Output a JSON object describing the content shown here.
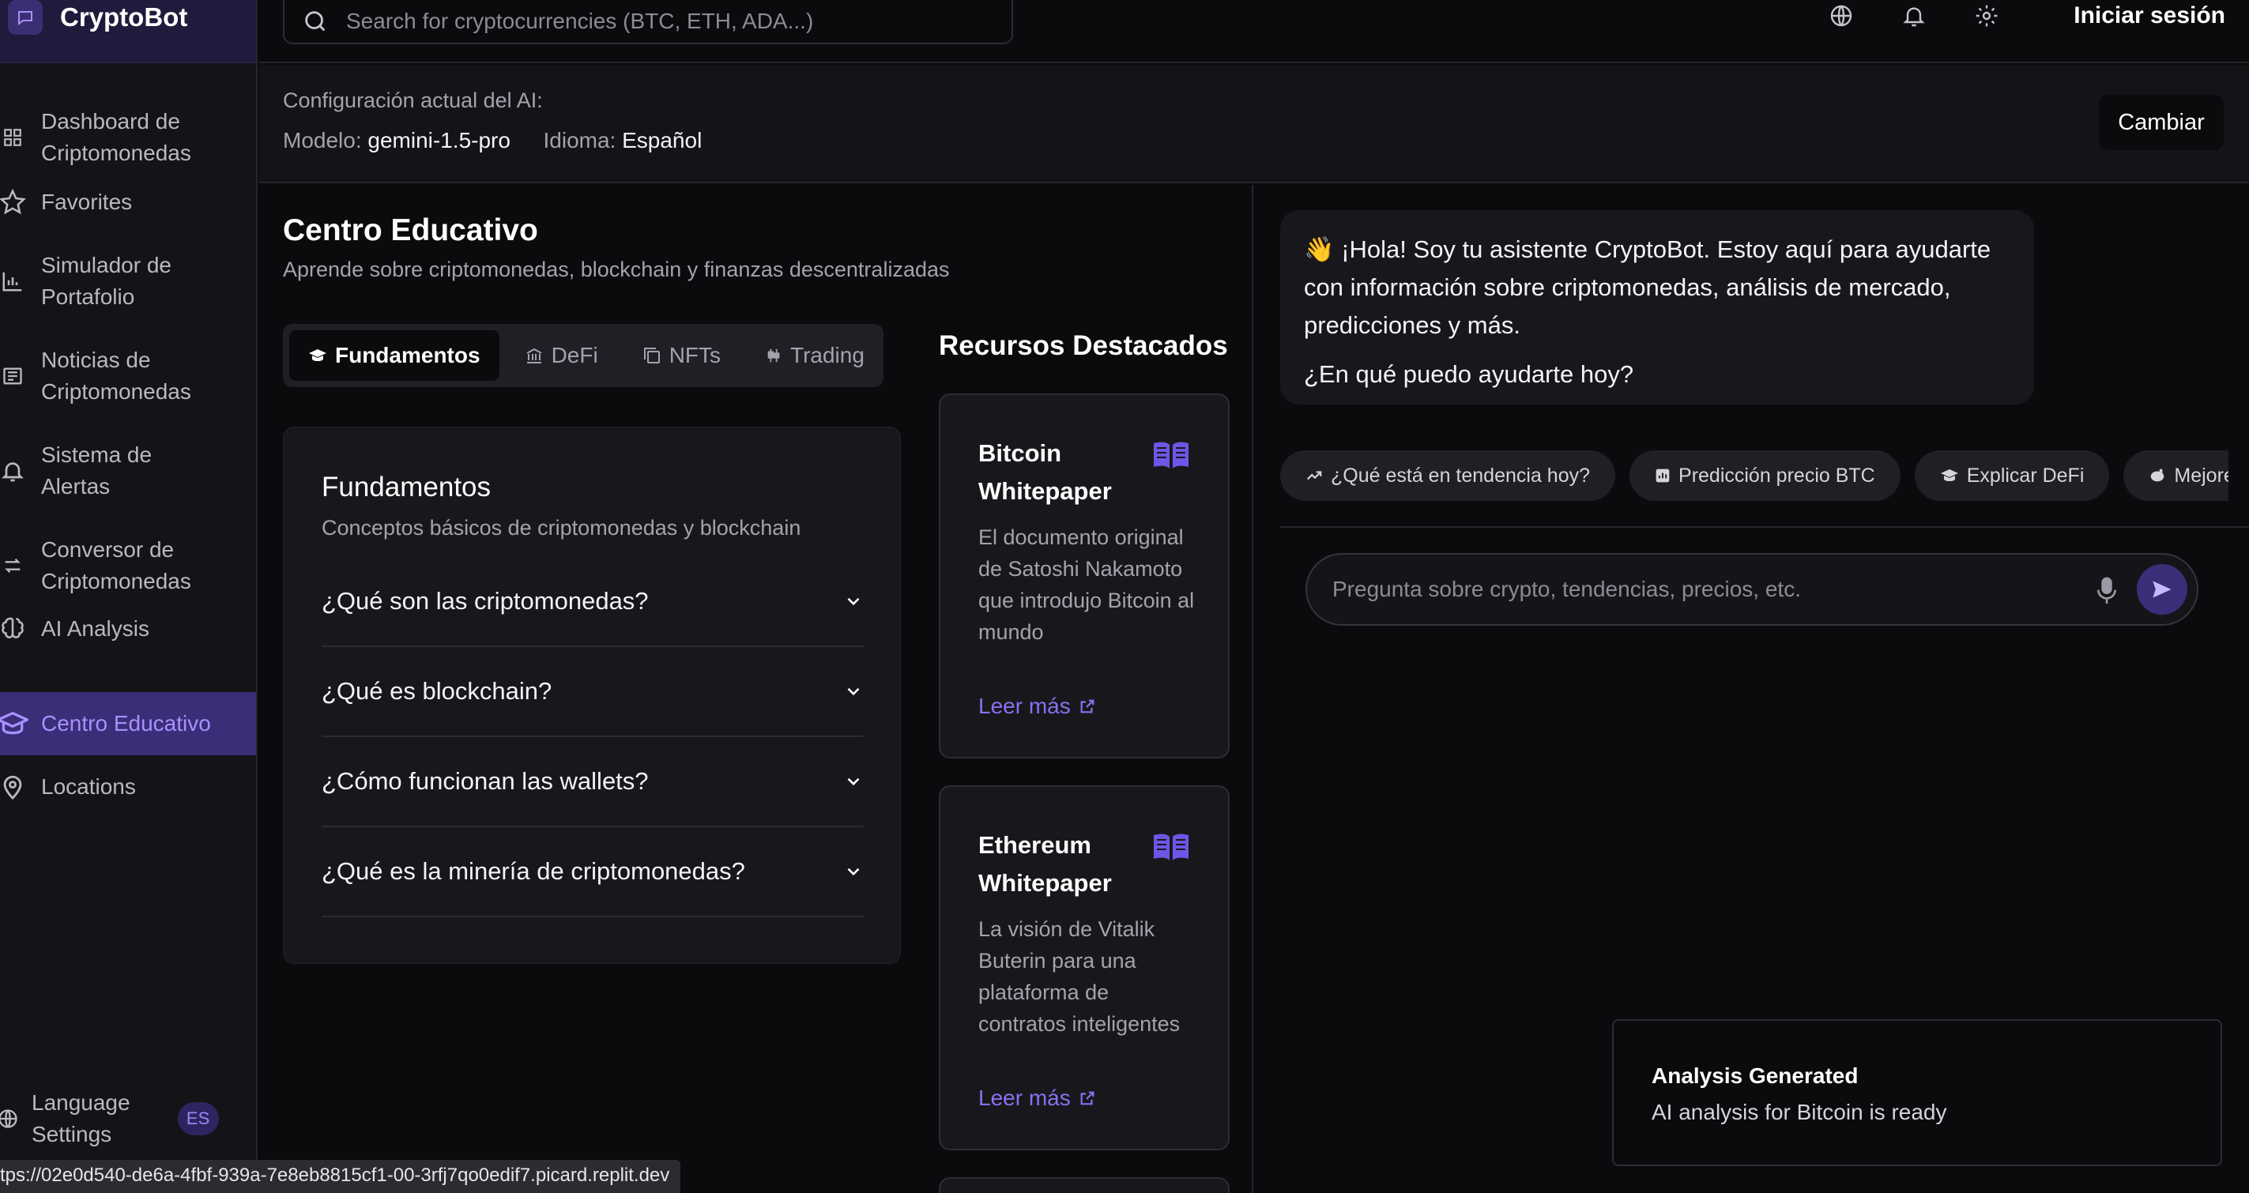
{
  "app": {
    "name": "CryptoBot"
  },
  "sidebar": {
    "items": [
      {
        "label_1": "Dashboard de",
        "label_2": "Criptomonedas",
        "icon": "dashboard-icon"
      },
      {
        "label_1": "Favorites",
        "label_2": "",
        "icon": "star-icon"
      },
      {
        "label_1": "Simulador de",
        "label_2": "Portafolio",
        "icon": "bar-chart-icon"
      },
      {
        "label_1": "Noticias de",
        "label_2": "Criptomonedas",
        "icon": "newspaper-icon"
      },
      {
        "label_1": "Sistema de",
        "label_2": "Alertas",
        "icon": "bell-icon"
      },
      {
        "label_1": "Conversor de",
        "label_2": "Criptomonedas",
        "icon": "arrows-exchange-icon"
      },
      {
        "label_1": "AI Analysis",
        "label_2": "",
        "icon": "brain-icon"
      },
      {
        "label_1": "Centro Educativo",
        "label_2": "",
        "icon": "graduation-cap-icon",
        "active": true
      },
      {
        "label_1": "Locations",
        "label_2": "",
        "icon": "map-pin-icon"
      }
    ],
    "language": {
      "label_1": "Language",
      "label_2": "Settings",
      "badge": "ES"
    }
  },
  "topbar": {
    "search_placeholder": "Search for cryptocurrencies (BTC, ETH, ADA...)",
    "login_label": "Iniciar sesión"
  },
  "config": {
    "title": "Configuración actual del AI:",
    "model_label": "Modelo:",
    "model_value": "gemini-1.5-pro",
    "language_label": "Idioma:",
    "language_value": "Español",
    "change_button": "Cambiar"
  },
  "education": {
    "title": "Centro Educativo",
    "subtitle": "Aprende sobre criptomonedas, blockchain y finanzas descentralizadas",
    "tabs": [
      {
        "label": "Fundamentos",
        "active": true
      },
      {
        "label": "DeFi"
      },
      {
        "label": "NFTs"
      },
      {
        "label": "Trading"
      }
    ],
    "card": {
      "title": "Fundamentos",
      "subtitle": "Conceptos básicos de criptomonedas y blockchain",
      "questions": [
        "¿Qué son las criptomonedas?",
        "¿Qué es blockchain?",
        "¿Cómo funcionan las wallets?",
        "¿Qué es la minería de criptomonedas?"
      ]
    },
    "resources": {
      "title": "Recursos Destacados",
      "items": [
        {
          "title": "Bitcoin Whitepaper",
          "description": "El documento original de Satoshi Nakamoto que introdujo Bitcoin al mundo",
          "link": "Leer más"
        },
        {
          "title": "Ethereum Whitepaper",
          "description": "La visión de Vitalik Buterin para una plataforma de contratos inteligentes",
          "link": "Leer más"
        }
      ]
    }
  },
  "chat": {
    "greeting_1": "👋 ¡Hola! Soy tu asistente CryptoBot. Estoy aquí para ayudarte con información sobre criptomonedas, análisis de mercado, predicciones y más.",
    "greeting_2": "¿En qué puedo ayudarte hoy?",
    "chips": [
      "¿Qué está en tendencia hoy?",
      "Predicción precio BTC",
      "Explicar DeFi",
      "Mejore"
    ],
    "input_placeholder": "Pregunta sobre crypto, tendencias, precios, etc."
  },
  "toast": {
    "title": "Analysis Generated",
    "message": "AI analysis for Bitcoin is ready"
  },
  "status_bar": {
    "url": "tps://02e0d540-de6a-4fbf-939a-7e8eb8815cf1-00-3rfj7qo0edif7.picard.replit.dev"
  },
  "colors": {
    "accent": "#3a2e78",
    "accent_text": "#8b6ff0",
    "background": "#0b0b0d",
    "panel": "#18181c"
  }
}
